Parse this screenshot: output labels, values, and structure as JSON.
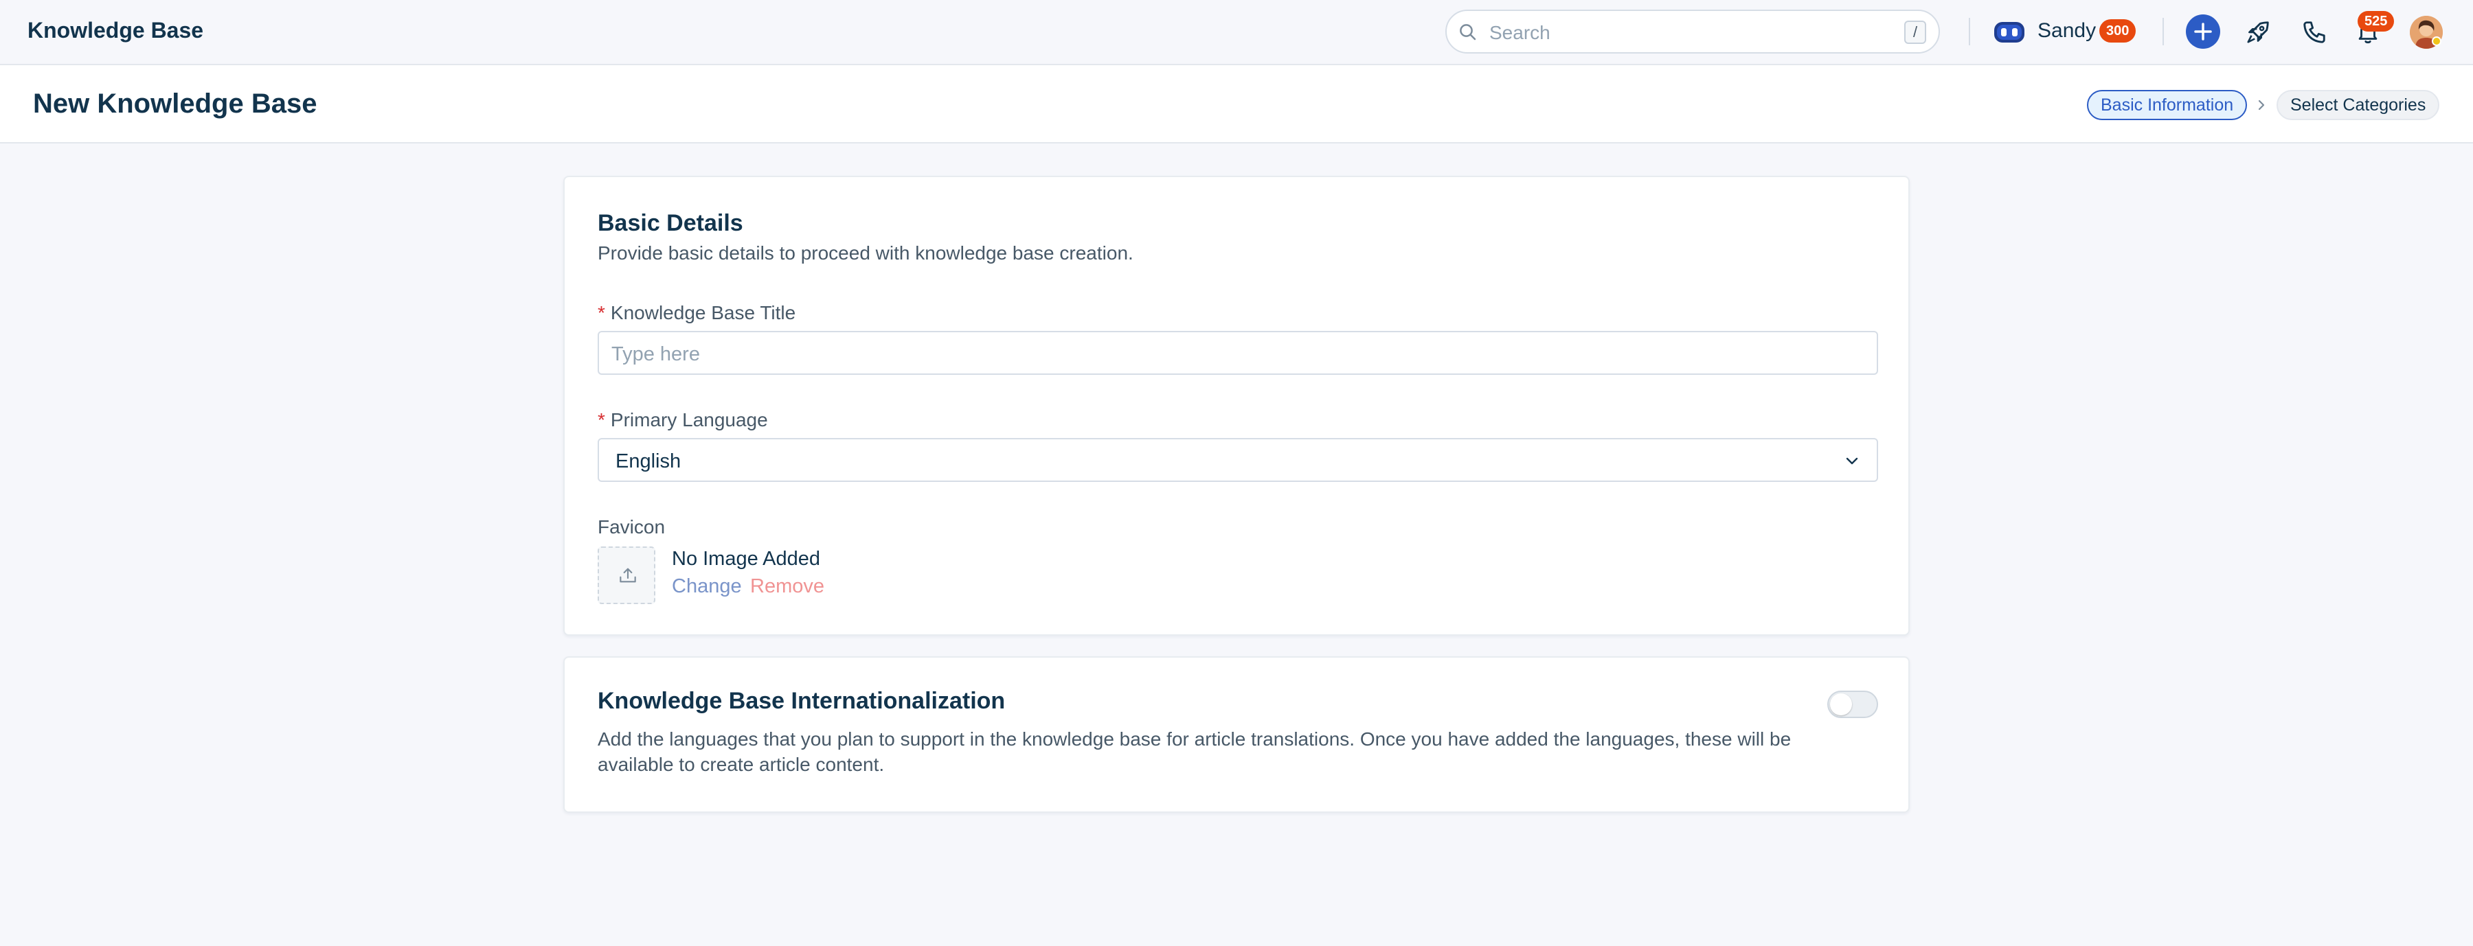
{
  "header": {
    "app_title": "Knowledge Base",
    "search": {
      "placeholder": "Search",
      "shortcut": "/"
    },
    "user": {
      "name": "Sandy",
      "badge": "300"
    },
    "notifications": {
      "count": "525"
    },
    "icons": [
      "search-icon",
      "bot-icon",
      "plus-icon",
      "rocket-icon",
      "phone-icon",
      "bell-icon",
      "avatar"
    ]
  },
  "subheader": {
    "title": "New Knowledge Base",
    "steps": [
      {
        "label": "Basic Information",
        "active": true
      },
      {
        "label": "Select Categories",
        "active": false
      }
    ]
  },
  "basic_details": {
    "title": "Basic Details",
    "description": "Provide basic details to proceed with knowledge base creation.",
    "required_marker": "*",
    "title_field": {
      "label": "Knowledge Base Title",
      "placeholder": "Type here",
      "value": ""
    },
    "language_field": {
      "label": "Primary Language",
      "value": "English"
    },
    "favicon": {
      "label": "Favicon",
      "status": "No Image Added",
      "change_label": "Change",
      "remove_label": "Remove"
    }
  },
  "internationalization": {
    "title": "Knowledge Base Internationalization",
    "description_line1": "Add the languages that you plan to support in the knowledge base for article translations. Once you have added the languages, these will be",
    "description_line2": "available to create article content.",
    "enabled": false
  },
  "colors": {
    "primary": "#2c5cc5",
    "badge": "#e8490f",
    "text": "#12344d",
    "muted": "#475867",
    "required": "#d72d30"
  }
}
